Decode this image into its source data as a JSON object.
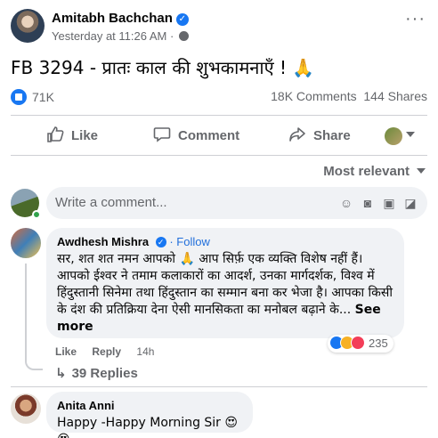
{
  "post": {
    "author": "Amitabh Bachchan",
    "timestamp": "Yesterday at 11:26 AM · ",
    "text": "FB 3294 - प्रातः काल की शुभकामनाएँ ! 🙏"
  },
  "stats": {
    "likes": "71K",
    "comments": "18K Comments",
    "shares": "144 Shares"
  },
  "actions": {
    "like": "Like",
    "comment": "Comment",
    "share": "Share"
  },
  "sort": {
    "label": "Most relevant"
  },
  "composer": {
    "placeholder": "Write a comment..."
  },
  "comments": [
    {
      "name": "Awdhesh Mishra",
      "follow": "Follow",
      "text": "सर, शत शत नमन आपको 🙏 आप सिर्फ़ एक व्यक्ति विशेष नहीं हैं। आपको ईश्वर ने तमाम कलाकारों का आदर्श, उनका मार्गदर्शक, विश्व में हिंदुस्तानी सिनेमा तथा हिंदुस्तान का सम्मान बना कर भेजा है। आपका किसी के दंश की प्रतिक्रिया देना ऐसी मानसिकता का मनोबल बढ़ाने के...",
      "see_more": "See more",
      "reaction_count": "235",
      "like_label": "Like",
      "reply_label": "Reply",
      "age": "14h",
      "replies": "39 Replies"
    },
    {
      "name": "Anita Anni",
      "text": "Happy -Happy Morning Sir 😍😍"
    }
  ],
  "colors": {
    "accent": "#1877f2",
    "muted": "#65676b",
    "bubble": "#f0f2f5"
  }
}
